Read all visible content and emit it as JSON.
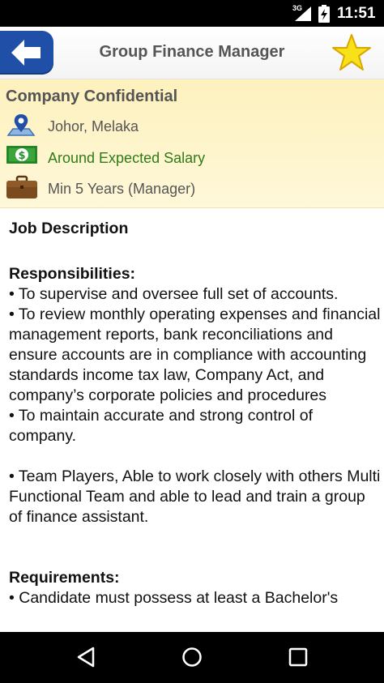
{
  "status_bar": {
    "network": "3G",
    "time": "11:51"
  },
  "app_bar": {
    "title": "Group Finance Manager"
  },
  "job": {
    "company": "Company Confidential",
    "location": "Johor, Melaka",
    "salary": "Around Expected Salary",
    "experience": "Min 5 Years (Manager)"
  },
  "description": {
    "heading": "Job Description",
    "responsibilities_heading": "Responsibilities:",
    "resp_1": "• To supervise and oversee full set of accounts.",
    "resp_2": "• To review monthly operating expenses and financial management reports, bank reconciliations and ensure accounts are in compliance with accounting standards income tax law, Company Act, and company’s corporate policies and procedures",
    "resp_3": "• To maintain accurate and strong control of company.",
    "resp_4": "• Team Players, Able to work closely with others Multi Functional Team and able to lead and train a group of finance assistant.",
    "requirements_heading": "Requirements:",
    "req_1": "• Candidate must possess at least a Bachelor's"
  },
  "colors": {
    "accent_blue": "#1f4fa6",
    "header_bg": "#fdf1bd",
    "salary_green": "#2f7b18",
    "star_yellow": "#f9e11a"
  }
}
